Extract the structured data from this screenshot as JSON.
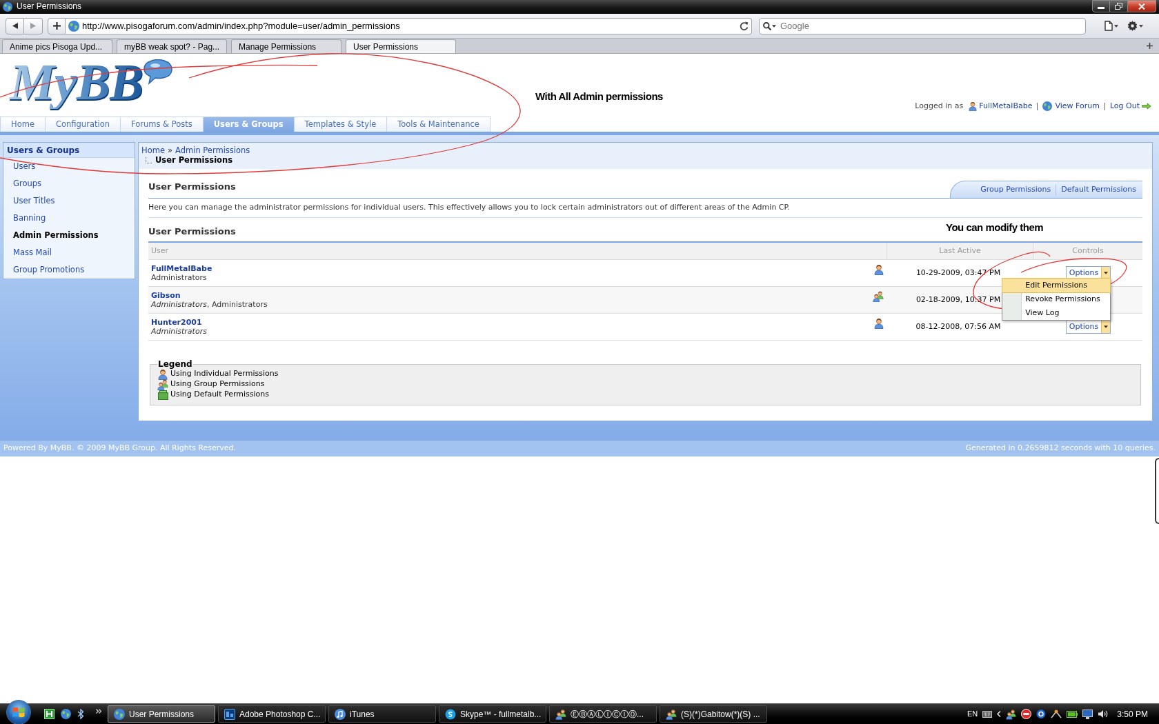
{
  "window": {
    "title": "User Permissions"
  },
  "toolbar": {
    "url": "http://www.pisogaforum.com/admin/index.php?module=user/admin_permissions",
    "search_placeholder": "Google"
  },
  "browser_tabs": [
    {
      "label": "Anime pics Pisoga Upd...",
      "selected": false
    },
    {
      "label": "myBB weak spot? - Pag...",
      "selected": false
    },
    {
      "label": "Manage Permissions",
      "selected": false
    },
    {
      "label": "User Permissions",
      "selected": true
    }
  ],
  "header": {
    "logo": "MyBB",
    "annotation": "With All Admin permissions",
    "logged_in_label": "Logged in as",
    "username": "FullMetalBabe",
    "links": [
      {
        "kind": "forum",
        "label": "View Forum"
      },
      {
        "kind": "logout",
        "label": "Log Out"
      }
    ]
  },
  "nav_tabs": [
    {
      "label": "Home",
      "selected": false
    },
    {
      "label": "Configuration",
      "selected": false
    },
    {
      "label": "Forums & Posts",
      "selected": false
    },
    {
      "label": "Users & Groups",
      "selected": true
    },
    {
      "label": "Templates & Style",
      "selected": false
    },
    {
      "label": "Tools & Maintenance",
      "selected": false
    }
  ],
  "sidebar": {
    "title": "Users & Groups",
    "items": [
      {
        "label": "Users",
        "selected": false
      },
      {
        "label": "Groups",
        "selected": false
      },
      {
        "label": "User Titles",
        "selected": false
      },
      {
        "label": "Banning",
        "selected": false
      },
      {
        "label": "Admin Permissions",
        "selected": true
      },
      {
        "label": "Mass Mail",
        "selected": false
      },
      {
        "label": "Group Promotions",
        "selected": false
      }
    ]
  },
  "breadcrumb": {
    "links": [
      "Home",
      "Admin Permissions"
    ],
    "separator": "»",
    "current": "User Permissions"
  },
  "page": {
    "title": "User Permissions",
    "tabs": [
      {
        "label": "Group Permissions",
        "selected": false
      },
      {
        "label": "Default Permissions",
        "selected": false
      }
    ],
    "description": "Here you can manage the administrator permissions for individual users. This effectively allows you to lock certain administrators out of different areas of the Admin CP.",
    "annotation": "You can modify them"
  },
  "table": {
    "title": "User Permissions",
    "columns": [
      "User",
      "Last Active",
      "Controls"
    ],
    "rows": [
      {
        "name": "FullMetalBabe",
        "groups": "Administrators",
        "italic": false,
        "kind": "individual",
        "last_active": "10-29-2009, 03:47 PM",
        "control": "Options",
        "menu_open": true
      },
      {
        "name": "Gibson",
        "groups": "*Administrators*, Administrators",
        "italic": false,
        "kind": "group",
        "last_active": "02-18-2009, 10:37 PM",
        "menu_open": false
      },
      {
        "name": "Hunter2001",
        "groups": "Administrators",
        "italic": true,
        "kind": "individual",
        "last_active": "08-12-2008, 07:56 AM",
        "control": "Options",
        "menu_open": false
      }
    ],
    "menu": [
      {
        "label": "Edit Permissions",
        "selected": true
      },
      {
        "label": "Revoke Permissions",
        "selected": false
      },
      {
        "label": "View Log",
        "selected": false
      }
    ]
  },
  "legend": {
    "title": "Legend",
    "items": [
      {
        "kind": "individual",
        "label": "Using Individual Permissions"
      },
      {
        "kind": "group",
        "label": "Using Group Permissions"
      },
      {
        "kind": "default",
        "label": "Using Default Permissions"
      }
    ]
  },
  "footer": {
    "copyright": "Powered By MyBB. © 2009 MyBB Group. All Rights Reserved.",
    "stats": "Generated in 0.2659812 seconds with 10 queries."
  },
  "taskbar": {
    "tasks": [
      {
        "kind": "browser",
        "label": "User Permissions",
        "selected": true
      },
      {
        "kind": "photoshop",
        "label": "Adobe Photoshop C...",
        "selected": false
      },
      {
        "kind": "music",
        "label": "iTunes",
        "selected": false
      },
      {
        "kind": "skype",
        "label": "Skype™ - fullmetalb...",
        "selected": false
      },
      {
        "kind": "chat",
        "label": "ⒺⒷⒶⓁⒾⒸⒾⓄ...",
        "selected": false
      },
      {
        "kind": "chat",
        "label": "(S)(*)Gabitow(*)(S) ...",
        "selected": false
      }
    ],
    "language": "EN",
    "clock": "3:50 PM"
  }
}
